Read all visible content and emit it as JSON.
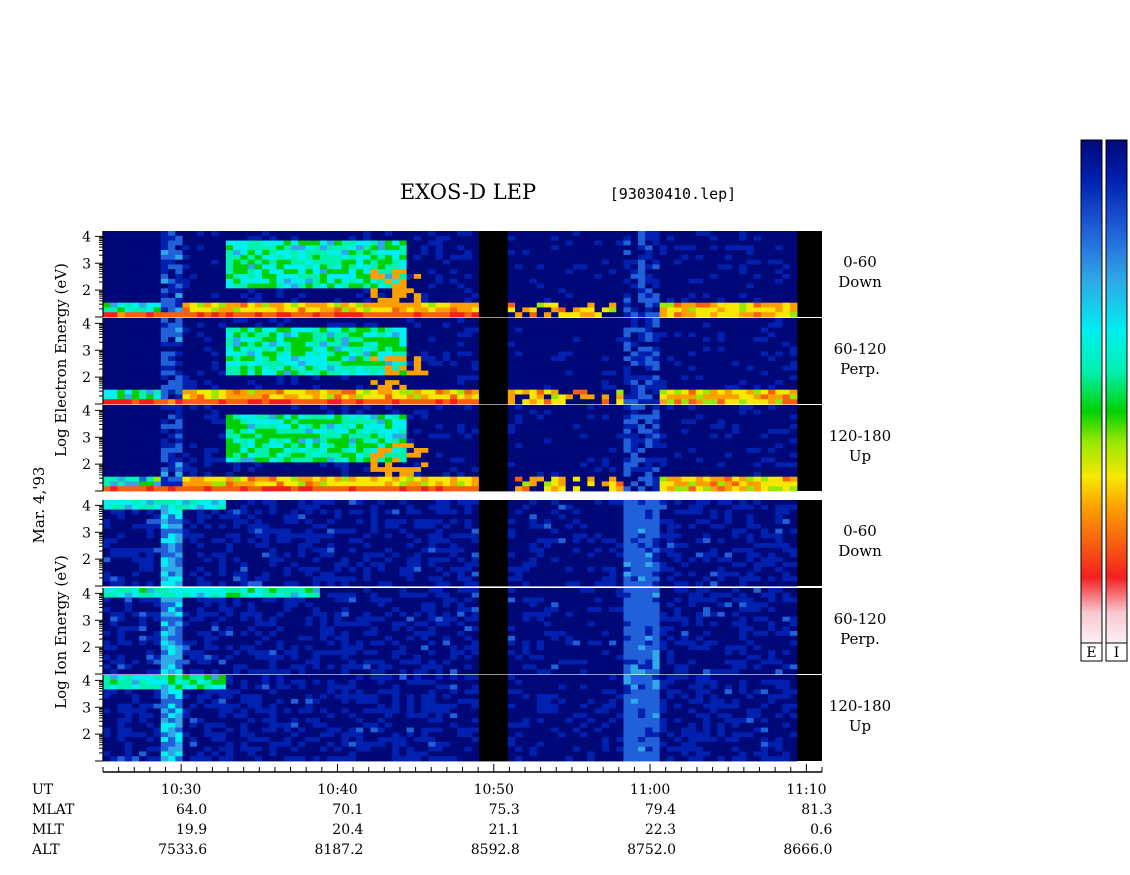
{
  "title": "EXOS-D LEP",
  "file_label": "[93030410.lep]",
  "date_label": "Mar. 4,'93",
  "chart_data": {
    "type": "heatmap",
    "x_axis": {
      "range_ut": [
        "10:25",
        "11:11"
      ],
      "tick_labels": [
        "10:30",
        "10:40",
        "10:50",
        "11:00",
        "11:10"
      ]
    },
    "y_axis": {
      "scale": "log",
      "range": [
        1,
        4.2
      ],
      "ticks": [
        "4",
        "3",
        "2"
      ],
      "ticks_full": [
        "4",
        "3",
        "2"
      ]
    },
    "groups": [
      {
        "label_words": [
          "Electron",
          "Energy",
          "Log",
          "(eV)"
        ],
        "label_text": "Log Electron Energy (eV)",
        "panels": [
          {
            "range": "0-60",
            "direction": "Down"
          },
          {
            "range": "60-120",
            "direction": "Perp."
          },
          {
            "range": "120-180",
            "direction": "Up"
          }
        ]
      },
      {
        "label_words": [
          "Ion",
          "Energy",
          "Log",
          "(eV)"
        ],
        "label_text": "Log Ion Energy (eV)",
        "panels": [
          {
            "range": "0-60",
            "direction": "Down"
          },
          {
            "range": "60-120",
            "direction": "Perp."
          },
          {
            "range": "120-180",
            "direction": "Up"
          }
        ]
      }
    ],
    "ephemeris": {
      "row_labels": [
        "UT",
        "MLAT",
        "MLT",
        "ALT"
      ],
      "MLAT": [
        "64.0",
        "70.1",
        "75.3",
        "79.4",
        "81.3"
      ],
      "MLT": [
        "19.9",
        "20.4",
        "21.1",
        "22.3",
        "0.6"
      ],
      "ALT": [
        "7533.6",
        "8187.2",
        "8592.8",
        "8752.0",
        "8666.0"
      ]
    },
    "colorbars": [
      "E",
      "I"
    ],
    "colormap": [
      "#fbf0f4",
      "#f8c8d0",
      "#f42020",
      "#f86010",
      "#fca000",
      "#f8e800",
      "#98e800",
      "#00d000",
      "#00f0b0",
      "#00f0f0",
      "#30a8e8",
      "#2060d8",
      "#0020b0",
      "#000878"
    ]
  }
}
